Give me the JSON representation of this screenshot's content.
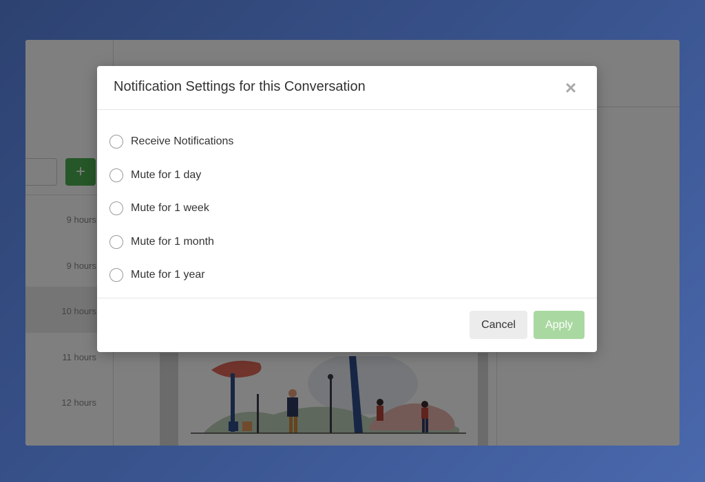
{
  "background_colors": {
    "gradient_start": "#2d4270",
    "gradient_end": "#4a68ad"
  },
  "app": {
    "add_button_label": "+",
    "conversations": [
      {
        "time": "9 hours",
        "active": false
      },
      {
        "time": "9 hours",
        "active": false
      },
      {
        "time": "10 hours",
        "active": true
      },
      {
        "time": "11 hours",
        "active": false
      },
      {
        "time": "12 hours",
        "active": false
      }
    ]
  },
  "modal": {
    "title": "Notification Settings for this Conversation",
    "close_icon": "close-icon",
    "options": [
      {
        "label": "Receive Notifications",
        "selected": false
      },
      {
        "label": "Mute for 1 day",
        "selected": false
      },
      {
        "label": "Mute for 1 week",
        "selected": false
      },
      {
        "label": "Mute for 1 month",
        "selected": false
      },
      {
        "label": "Mute for 1 year",
        "selected": false
      }
    ],
    "cancel_label": "Cancel",
    "apply_label": "Apply",
    "apply_color": "#a9d8a0",
    "apply_disabled": true
  }
}
